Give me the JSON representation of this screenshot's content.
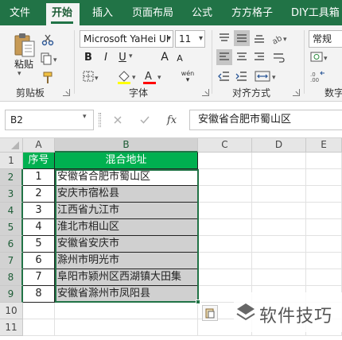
{
  "tabs": [
    "文件",
    "开始",
    "插入",
    "页面布局",
    "公式",
    "方方格子",
    "DIY工具箱"
  ],
  "active_tab": "开始",
  "ribbon": {
    "clipboard": {
      "paste_label": "粘贴",
      "group_label": "剪贴板"
    },
    "font": {
      "font_name": "Microsoft YaHei UI",
      "font_size": "11",
      "bold": "B",
      "italic": "I",
      "underline": "U",
      "font_size_up": "A",
      "font_size_down": "A",
      "phonetic": "wén",
      "group_label": "字体",
      "fill_color": "#ffff00",
      "font_color": "#ff0000"
    },
    "alignment": {
      "group_label": "对齐方式"
    },
    "number": {
      "format": "常规",
      "group_label": "数字"
    }
  },
  "formula_bar": {
    "name_box": "B2",
    "fx": "fx",
    "content": "安徽省合肥市蜀山区"
  },
  "grid": {
    "columns": [
      "A",
      "B",
      "C",
      "D",
      "E"
    ],
    "rows": [
      "1",
      "2",
      "3",
      "4",
      "5",
      "6",
      "7",
      "8",
      "9",
      "10",
      "11"
    ],
    "header": {
      "a": "序号",
      "b": "混合地址"
    },
    "records": [
      {
        "no": "1",
        "address": "安徽省合肥市蜀山区"
      },
      {
        "no": "2",
        "address": "安庆市宿松县"
      },
      {
        "no": "3",
        "address": "江西省九江市"
      },
      {
        "no": "4",
        "address": "淮北市相山区"
      },
      {
        "no": "5",
        "address": "安徽省安庆市"
      },
      {
        "no": "6",
        "address": "滁州市明光市"
      },
      {
        "no": "7",
        "address": "阜阳市颍州区西湖镇大田集"
      },
      {
        "no": "8",
        "address": "安徽省滁州市凤阳县"
      }
    ],
    "header_color": "#00b050",
    "selection_color": "#d0d0d0"
  },
  "watermark": "软件技巧"
}
